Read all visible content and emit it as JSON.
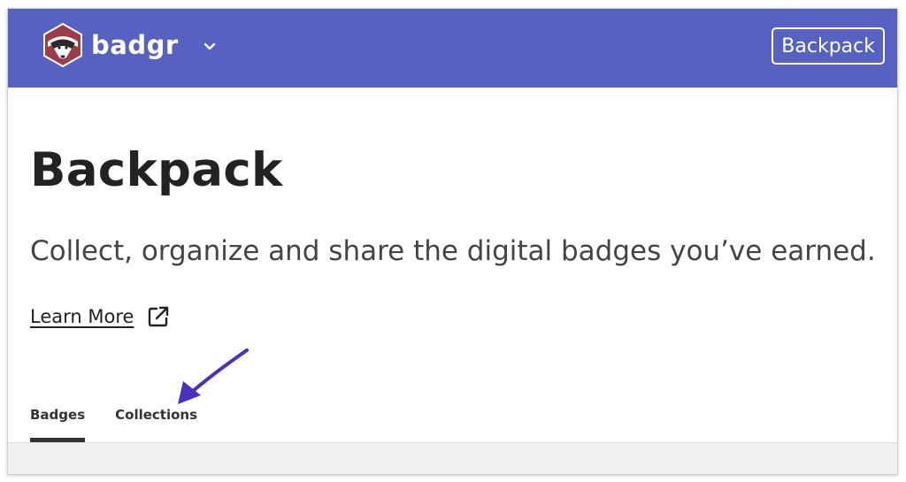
{
  "header": {
    "brand_name": "badgr",
    "backpack_button": "Backpack",
    "background_color": "#5562c2",
    "menu_icon": "chevron-down-icon"
  },
  "main": {
    "title": "Backpack",
    "subtitle": "Collect, organize and share the digital badges you’ve earned.",
    "learn_more": "Learn More",
    "learn_more_icon": "external-link-icon"
  },
  "tabs": [
    {
      "label": "Badges",
      "active": true
    },
    {
      "label": "Collections",
      "active": false
    }
  ],
  "annotation": {
    "arrow_color": "#4a2fc0",
    "points_to": "Collections"
  }
}
